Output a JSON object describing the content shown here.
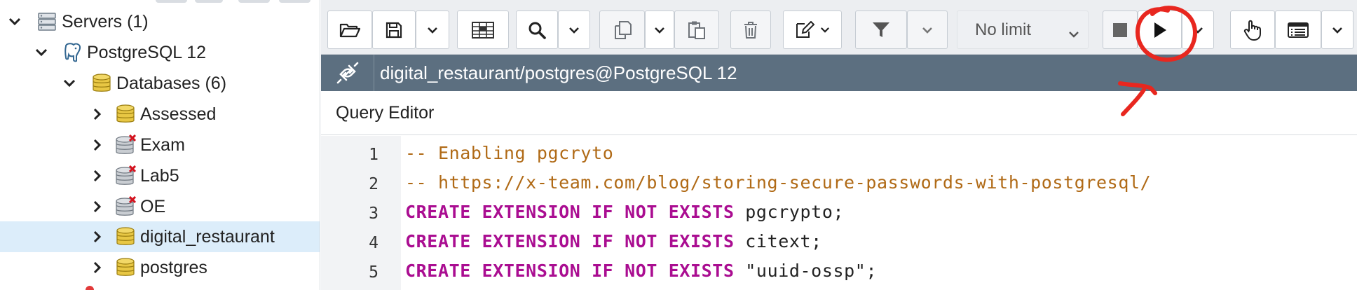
{
  "tree": {
    "nodes": [
      {
        "label": "Servers (1)",
        "icon": "servers-icon",
        "expanded": true,
        "depth": 0
      },
      {
        "label": "PostgreSQL 12",
        "icon": "postgresql-elephant-icon",
        "expanded": true,
        "depth": 1
      },
      {
        "label": "Databases (6)",
        "icon": "databases-icon",
        "expanded": true,
        "depth": 2
      },
      {
        "label": "Assessed",
        "icon": "database-icon",
        "expanded": false,
        "depth": 3
      },
      {
        "label": "Exam",
        "icon": "database-disconnected-icon",
        "expanded": false,
        "depth": 3
      },
      {
        "label": "Lab5",
        "icon": "database-disconnected-icon",
        "expanded": false,
        "depth": 3
      },
      {
        "label": "OE",
        "icon": "database-disconnected-icon",
        "expanded": false,
        "depth": 3
      },
      {
        "label": "digital_restaurant",
        "icon": "database-icon",
        "expanded": false,
        "depth": 3,
        "selected": true
      },
      {
        "label": "postgres",
        "icon": "database-icon",
        "expanded": false,
        "depth": 3
      }
    ]
  },
  "toolbar": {
    "limit_value": "No limit",
    "buttons": [
      "open-file-icon",
      "save-icon",
      "save-dropdown-icon",
      "edit-grid-icon",
      "find-icon",
      "find-dropdown-icon",
      "copy-icon",
      "copy-dropdown-icon",
      "paste-icon",
      "delete-icon",
      "edit-dropdown-icon",
      "filter-icon",
      "filter-dropdown-icon",
      "stop-icon",
      "execute-icon",
      "execute-dropdown-icon",
      "commit-icon",
      "explain-icon",
      "explain-dropdown-icon"
    ]
  },
  "connection": {
    "text": "digital_restaurant/postgres@PostgreSQL 12"
  },
  "editor": {
    "tab_label": "Query Editor",
    "line_numbers": [
      "1",
      "2",
      "3",
      "4",
      "5"
    ],
    "lines": [
      [
        {
          "t": "-- Enabling pgcryto",
          "c": "comment"
        }
      ],
      [
        {
          "t": "-- https://x-team.com/blog/storing-secure-passwords-with-postgresql/",
          "c": "comment"
        }
      ],
      [
        {
          "t": "CREATE",
          "c": "kw"
        },
        {
          "t": " ",
          "c": "plain"
        },
        {
          "t": "EXTENSION",
          "c": "kw"
        },
        {
          "t": " ",
          "c": "plain"
        },
        {
          "t": "IF",
          "c": "kw"
        },
        {
          "t": " ",
          "c": "plain"
        },
        {
          "t": "NOT",
          "c": "kw"
        },
        {
          "t": " ",
          "c": "plain"
        },
        {
          "t": "EXISTS",
          "c": "kw"
        },
        {
          "t": " pgcrypto;",
          "c": "plain"
        }
      ],
      [
        {
          "t": "CREATE",
          "c": "kw"
        },
        {
          "t": " ",
          "c": "plain"
        },
        {
          "t": "EXTENSION",
          "c": "kw"
        },
        {
          "t": " ",
          "c": "plain"
        },
        {
          "t": "IF",
          "c": "kw"
        },
        {
          "t": " ",
          "c": "plain"
        },
        {
          "t": "NOT",
          "c": "kw"
        },
        {
          "t": " ",
          "c": "plain"
        },
        {
          "t": "EXISTS",
          "c": "kw"
        },
        {
          "t": " citext;",
          "c": "plain"
        }
      ],
      [
        {
          "t": "CREATE",
          "c": "kw"
        },
        {
          "t": " ",
          "c": "plain"
        },
        {
          "t": "EXTENSION",
          "c": "kw"
        },
        {
          "t": " ",
          "c": "plain"
        },
        {
          "t": "IF",
          "c": "kw"
        },
        {
          "t": " ",
          "c": "plain"
        },
        {
          "t": "NOT",
          "c": "kw"
        },
        {
          "t": " ",
          "c": "plain"
        },
        {
          "t": "EXISTS",
          "c": "kw"
        },
        {
          "t": " \"uuid-ossp\";",
          "c": "plain"
        }
      ]
    ]
  },
  "colors": {
    "annotation": "#e8271f",
    "connection_bar": "#5c6f80",
    "selection": "#dcedfa",
    "keyword": "#aa0d91",
    "comment": "#b06a16"
  }
}
